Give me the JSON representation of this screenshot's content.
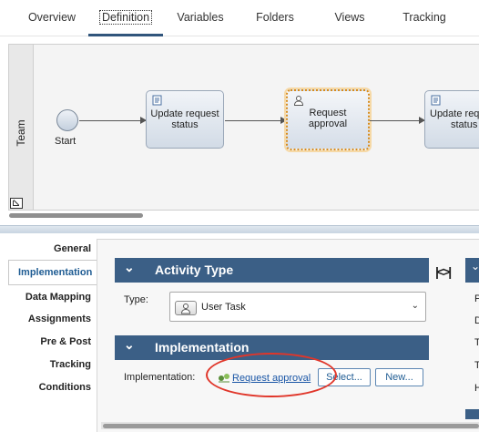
{
  "tabs": [
    "Overview",
    "Definition",
    "Variables",
    "Folders",
    "Views",
    "Tracking"
  ],
  "diagram": {
    "lane": "Team",
    "start_label": "Start",
    "tasks": [
      {
        "label_line1": "Update request",
        "label_line2": "status"
      },
      {
        "label_line1": "Request",
        "label_line2": "approval"
      },
      {
        "label_line1": "Update req",
        "label_line2": "status"
      }
    ]
  },
  "properties": {
    "nav": [
      "General",
      "Implementation",
      "Data Mapping",
      "Assignments",
      "Pre & Post",
      "Tracking",
      "Conditions"
    ],
    "active_nav": "Implementation",
    "activity_type_section": "Activity Type",
    "type_label": "Type:",
    "type_value": "User Task",
    "implementation_section": "Implementation",
    "implementation_label": "Implementation:",
    "implementation_link": "Request approval",
    "select_button": "Select...",
    "new_button": "New...",
    "side_toggle": "|<>|",
    "right_letters": [
      "P",
      "D",
      "T",
      "T",
      "H"
    ]
  },
  "colors": {
    "section_bar": "#3b5f86",
    "active_tab_underline": "#30557c",
    "selected_task_border": "#d78c1e",
    "highlight_ring": "#e0362a"
  }
}
